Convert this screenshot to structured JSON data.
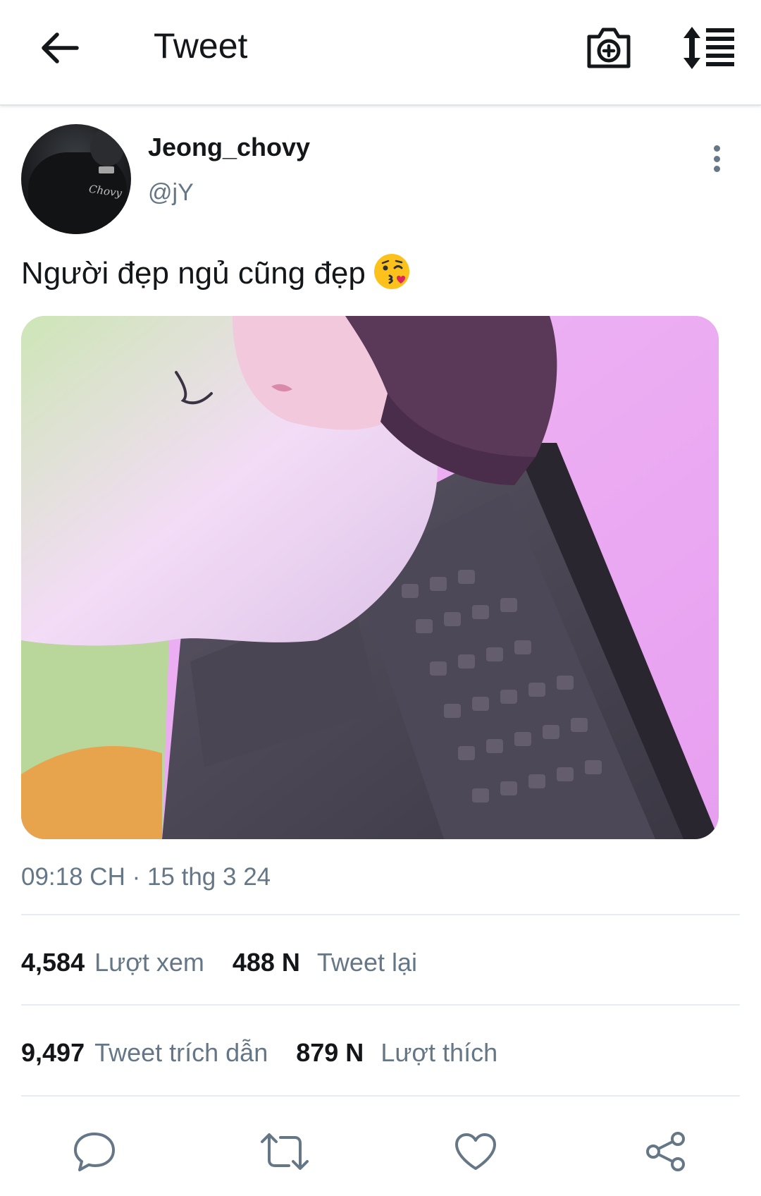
{
  "header": {
    "title": "Tweet",
    "back_icon": "arrow-left-icon",
    "camera_icon": "camera-add-icon",
    "sort_icon": "sort-list-icon"
  },
  "author": {
    "display_name": "Jeong_chovy",
    "handle": "@jY",
    "avatar_text": "Chovy"
  },
  "tweet": {
    "text": "Người đẹp ngủ cũng đẹp",
    "emoji": "face-blowing-kiss-emoji",
    "timestamp": "09:18 CH · 15 thg 3 24"
  },
  "stats": {
    "views_count": "4,584",
    "views_label": "Lượt xem",
    "retweets_count": "488 N",
    "retweets_label": "Tweet lại",
    "quotes_count": "9,497",
    "quotes_label": "Tweet trích dẫn",
    "likes_count": "879 N",
    "likes_label": "Lượt thích"
  },
  "actions": {
    "reply_icon": "reply-bubble-icon",
    "retweet_icon": "retweet-icon",
    "like_icon": "heart-icon",
    "share_icon": "share-icon"
  },
  "colors": {
    "text_primary": "#14171a",
    "text_secondary": "#657786",
    "divider": "#e6ecf0"
  }
}
